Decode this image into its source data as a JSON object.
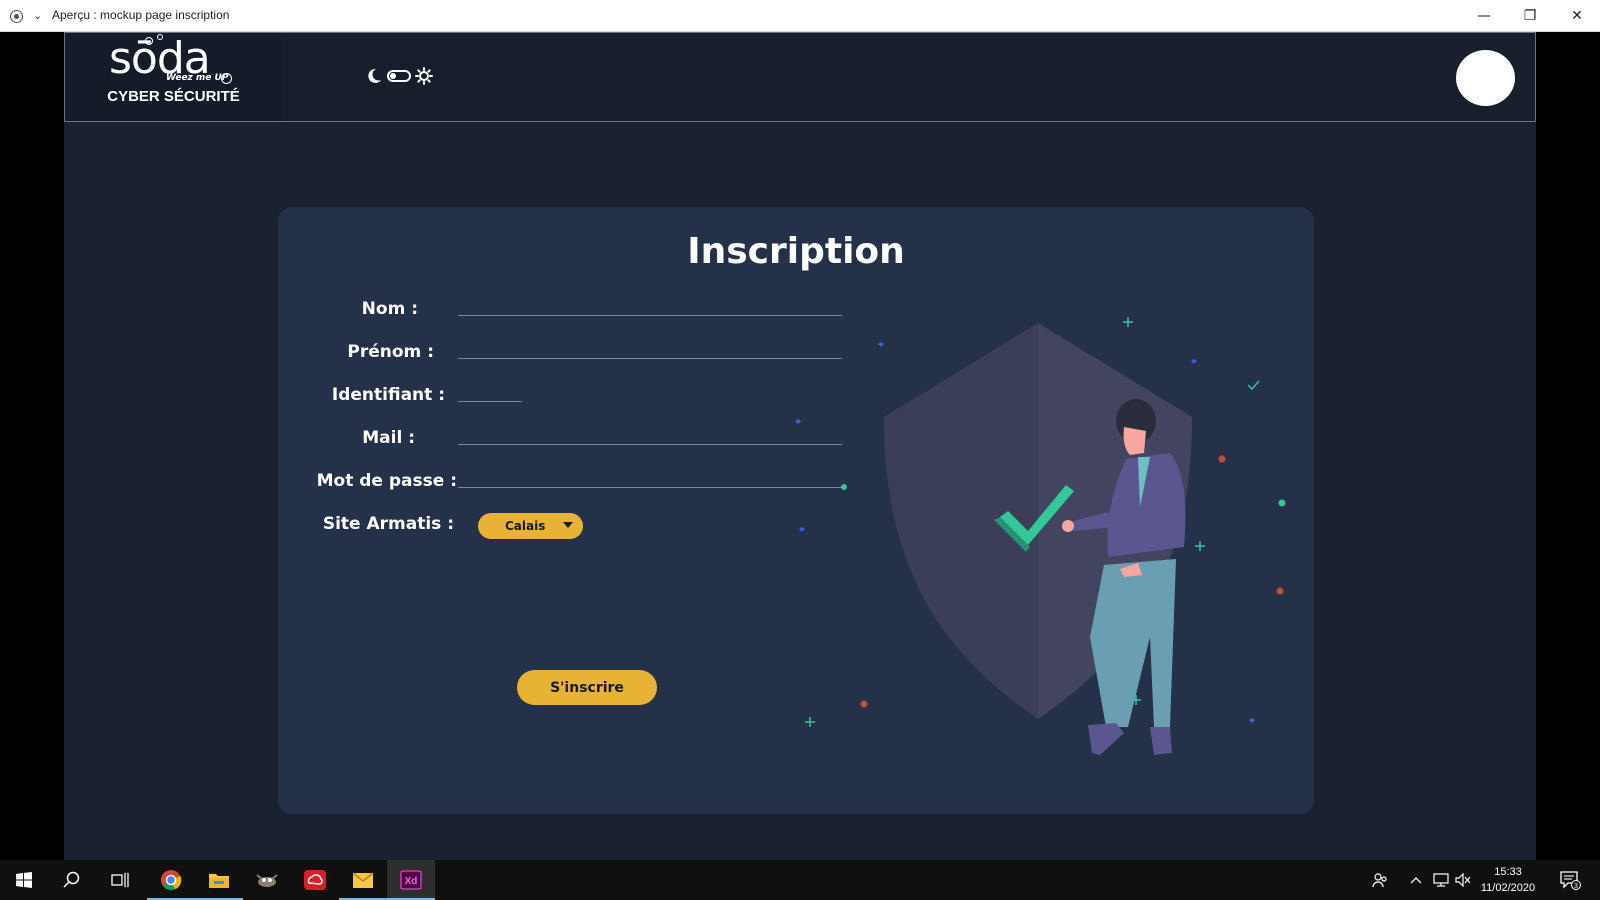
{
  "window": {
    "title": "Aperçu : mockup page inscription",
    "minimize_glyph": "—",
    "restore_glyph": "❐",
    "close_glyph": "✕"
  },
  "header": {
    "logo_text": "sōda",
    "logo_tagline": "Weez me UP",
    "logo_subtitle": "CYBER SÉCURITÉ"
  },
  "form": {
    "title": "Inscription",
    "fields": [
      {
        "label": "Nom :",
        "value": ""
      },
      {
        "label": "Prénom :",
        "value": ""
      },
      {
        "label": "Identifiant :",
        "value": ""
      },
      {
        "label": "Mail :",
        "value": ""
      },
      {
        "label": "Mot de passe :",
        "value": ""
      }
    ],
    "site_label": "Site Armatis :",
    "site_selected": "Calais",
    "submit_label": "S'inscrire"
  },
  "colors": {
    "accent": "#e8b236",
    "card": "#243149",
    "background": "#1a2130",
    "check": "#32c89a"
  },
  "taskbar": {
    "apps": [
      "start-icon",
      "search-icon",
      "task-view-icon",
      "chrome-icon",
      "file-explorer-icon",
      "gimp-icon",
      "creative-cloud-icon",
      "mail-app-icon",
      "adobe-xd-icon"
    ],
    "xd_label": "Xd",
    "time": "15:33",
    "date": "11/02/2020",
    "notification_count": "3"
  }
}
